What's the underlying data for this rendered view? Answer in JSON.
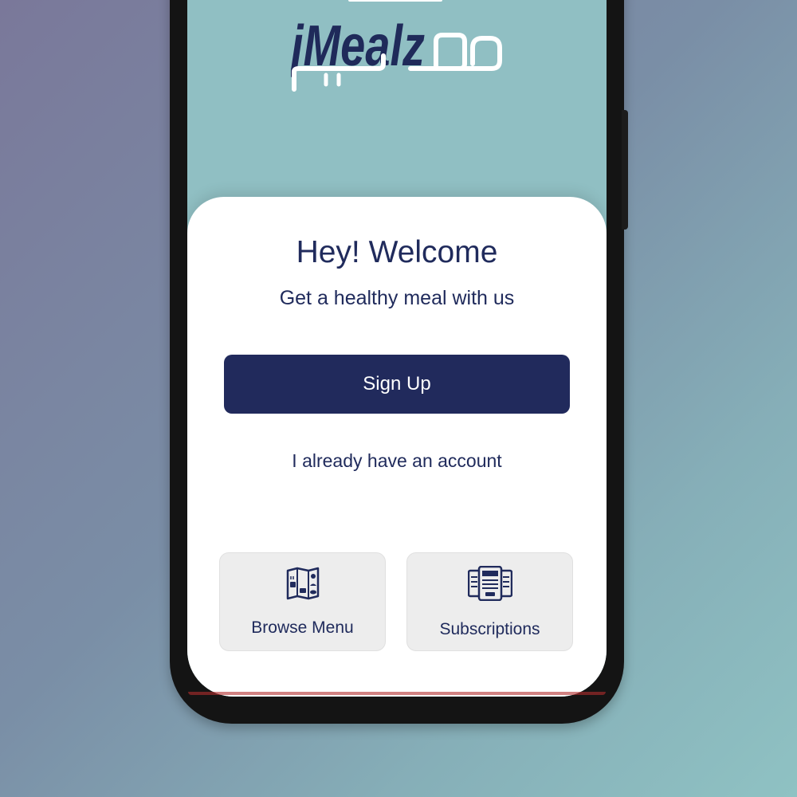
{
  "brand": {
    "logo_text": "jMealz",
    "logo_arabic": "ميلز",
    "colors": {
      "navy": "#212a5c",
      "teal_header": "#90bfc3",
      "card": "#ffffff",
      "tile": "#ededed"
    }
  },
  "welcome": {
    "title": "Hey! Welcome",
    "subtitle": "Get a healthy meal with us"
  },
  "actions": {
    "signup_label": "Sign Up",
    "login_label": "I already have an account"
  },
  "tiles": [
    {
      "label": "Browse Menu",
      "icon": "menu-booklet-icon"
    },
    {
      "label": "Subscriptions",
      "icon": "meal-plans-icon"
    }
  ]
}
